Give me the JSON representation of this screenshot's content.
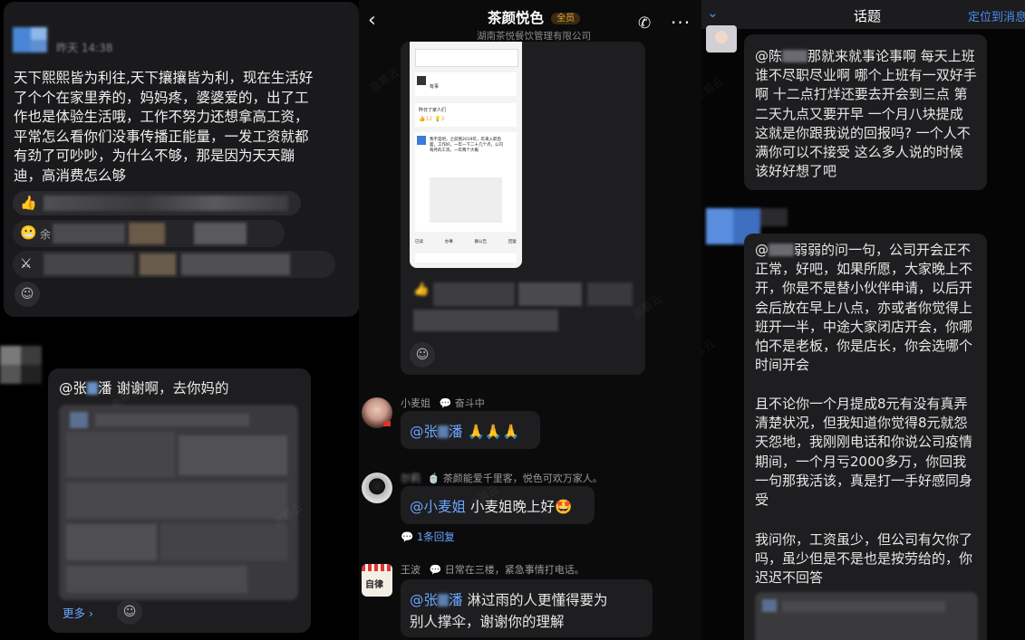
{
  "left": {
    "time": "昨天 14:38",
    "post": "天下熙熙皆为利往,天下攘攘皆为利，现在生活好了个个在家里养的，妈妈疼，婆婆爱的，出了工作也是体验生活哦，工作不努力还想拿高工资，平常怎么看你们没事传播正能量，一发工资就都有劲了可吵吵，为什么不够，那是因为天天蹦迪，高消费怎么够",
    "reaction_rows": [
      "",
      "余",
      ""
    ],
    "reply_text_mention": "@张",
    "reply_text_mention_end": "潘",
    "reply_text_rest": " 谢谢啊，去你妈的",
    "more_label": "更多",
    "chevron": "›"
  },
  "middle": {
    "title": "茶颜悦色",
    "badge": "全员",
    "subtitle": "湖南茶悦餐饮管理有限公司",
    "shot": {
      "row1": "有事",
      "row2": "昨日了家人们",
      "row3": "我不是吧，之前我2019年，年来入职后面，工作好，一年一下二十几个点，公司每月的工资，一年两个大概",
      "bottom_labels": [
        "已读",
        "办事",
        "群公告",
        "回复"
      ]
    },
    "messages": [
      {
        "name": "小麦姐",
        "status": "奋斗中",
        "mention": "@张",
        "mention_end": "潘",
        "text": " 🙏🙏🙏"
      },
      {
        "name": "尔莉",
        "status": "茶颜能爱千里客，悦色可欢万家人。",
        "mention": "@小麦姐",
        "mention_end": "",
        "text": " 小麦姐晚上好🤩",
        "reply_count": "1条回复"
      },
      {
        "name": "王波",
        "status": "日常在三楼，紧急事情打电话。",
        "mention": "@张",
        "mention_end": "潘",
        "text_line1": " 淋过雨的人更懂得要为",
        "text_line2": "别人撑伞，谢谢你的理解",
        "avatar_text": "自律"
      }
    ]
  },
  "right": {
    "title": "话题",
    "locate": "定位到消息",
    "msg1_mention": "@陈",
    "msg1_text": "那就来就事论事啊 每天上班谁不尽职尽业啊 哪个上班有一双好手啊 十二点打烊还要去开会到三点 第二天九点又要开早 一个月八块提成 这就是你跟我说的回报吗? 一个人不满你可以不接受 这么多人说的时候 该好好想了吧",
    "msg2_mention": "@",
    "msg2_p1": "弱弱的问一句，公司开会正不正常，好吧，如果所愿，大家晚上不开，你是不是替小伙伴申请，以后开会后放在早上八点，亦或者你觉得上班开一半，中途大家闭店开会，你哪怕不是老板，你是店长，你会选哪个时间开会",
    "msg2_p2": "且不论你一个月提成8元有没有真弄清楚状况，但我知道你觉得8元就怨天怨地，我刚刚电话和你说公司疫情期间，一个月亏2000多万，你回我一句那我活该，真是打一手好感同身受",
    "msg2_p3": "我问你，工资虽少，但公司有欠你了吗，虽少但是不是也是按劳给的，你迟迟不回答"
  },
  "watermark": "高慕云"
}
